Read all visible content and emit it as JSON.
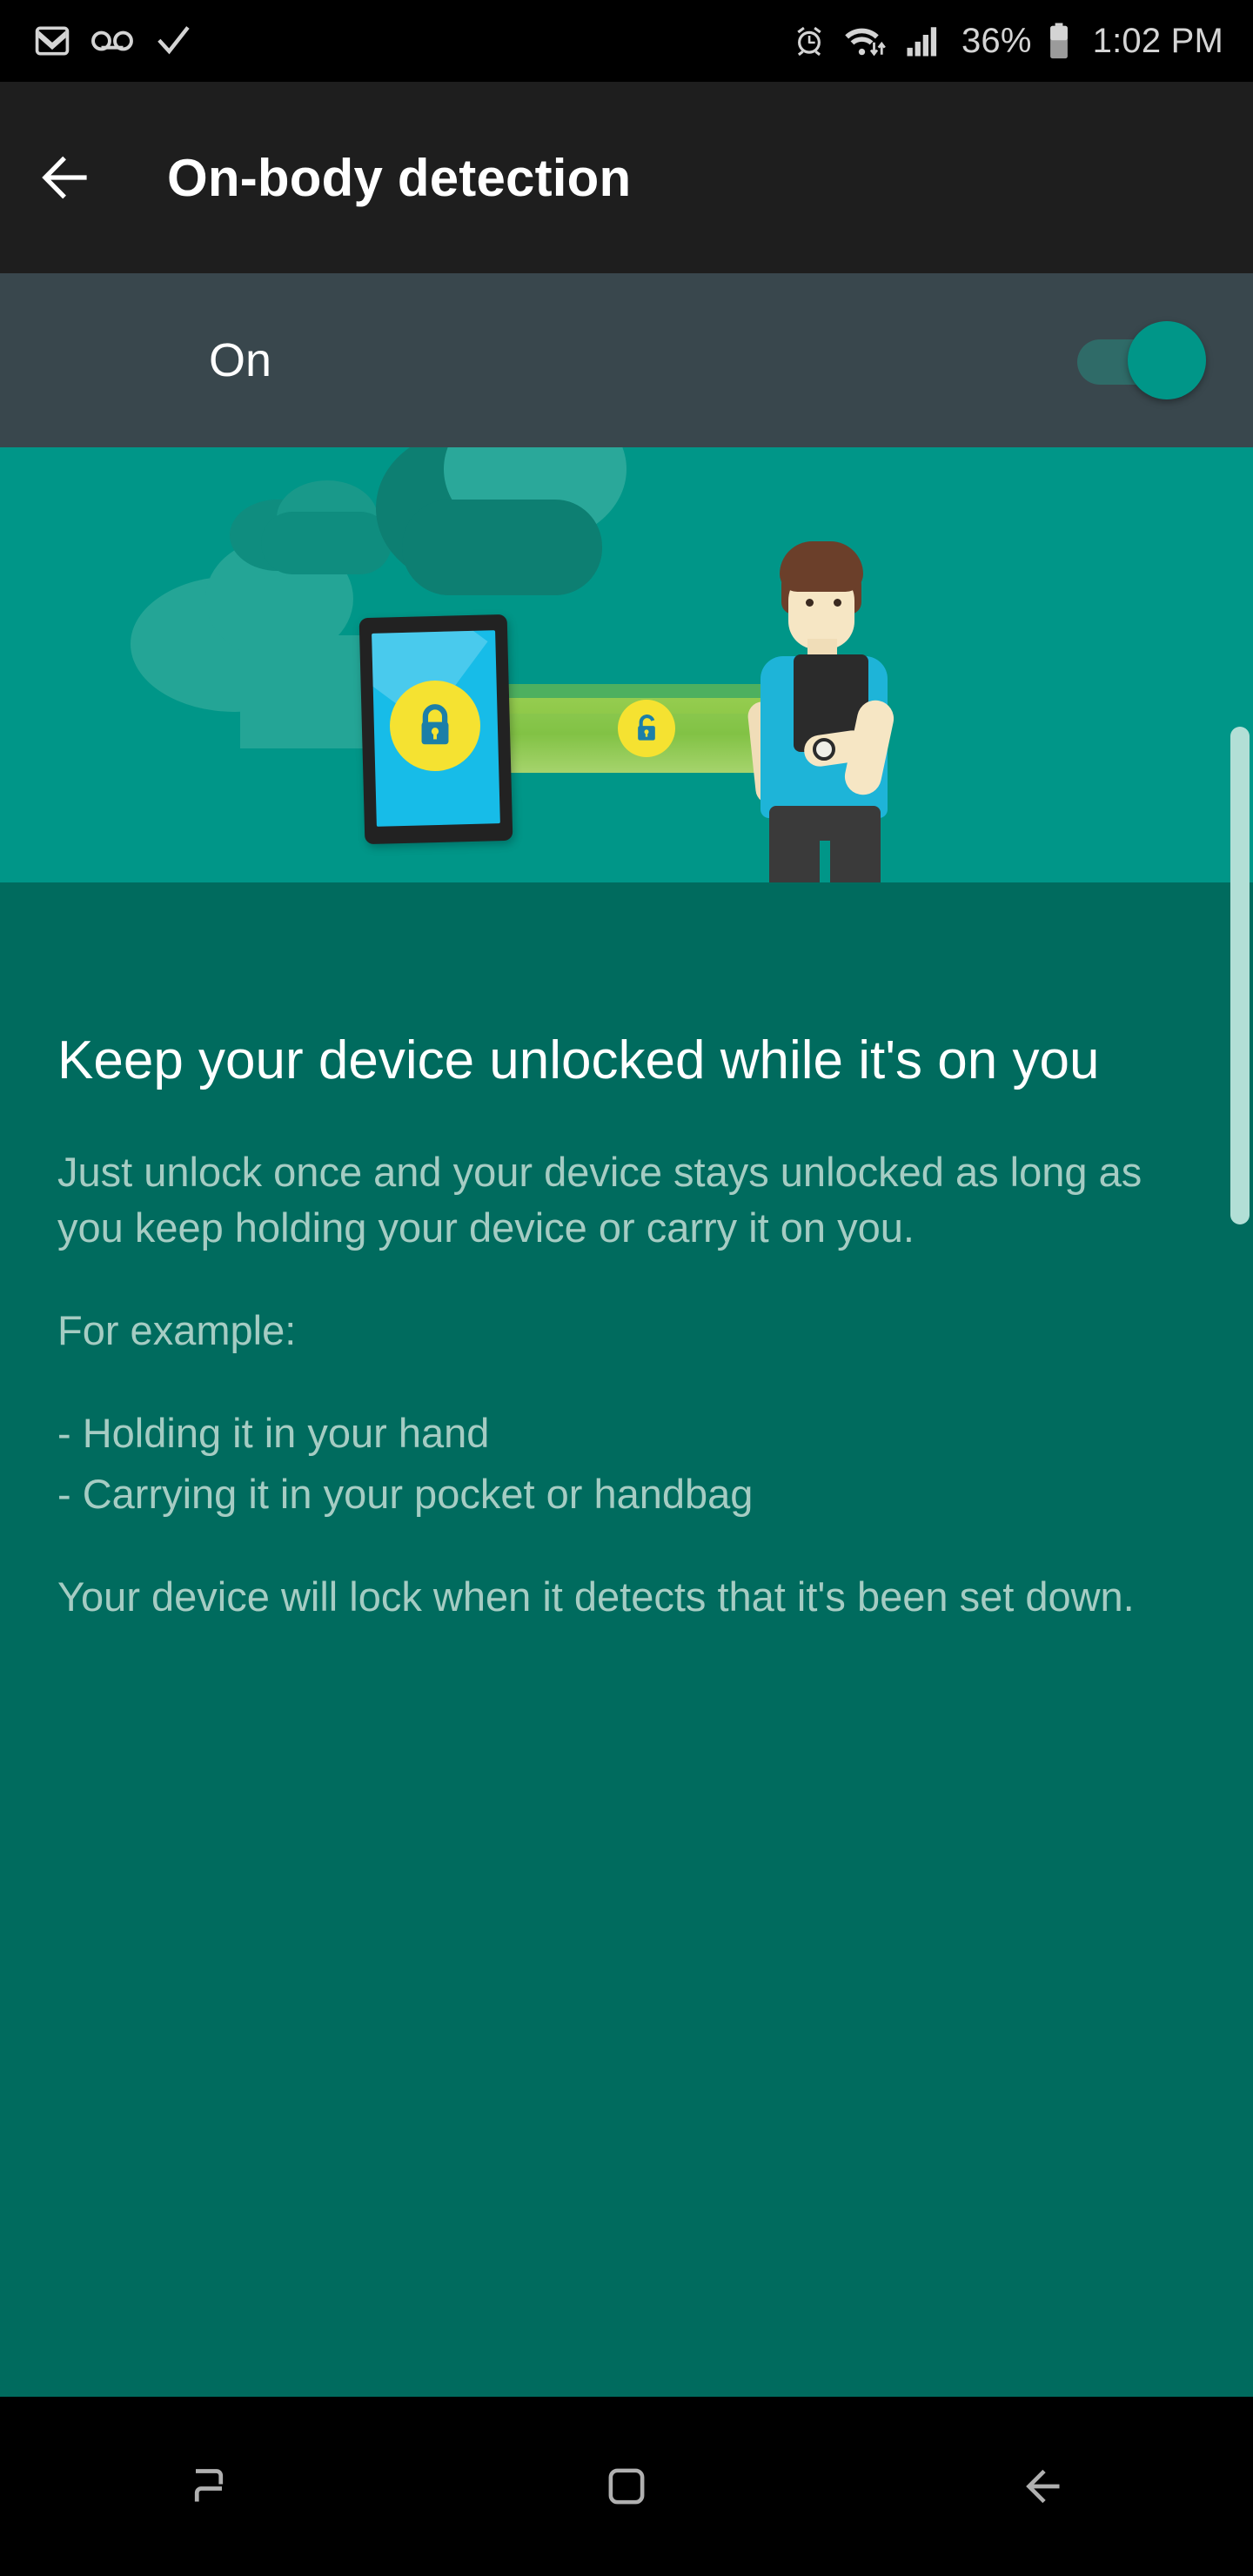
{
  "statusbar": {
    "left_icons": [
      "gmail-icon",
      "voicemail-icon",
      "check-icon"
    ],
    "right_icons": [
      "alarm-icon",
      "wifi-icon",
      "signal-icon",
      "battery-icon"
    ],
    "battery_percent": "36%",
    "time": "1:02 PM"
  },
  "appbar": {
    "back_icon": "back-arrow-icon",
    "title": "On-body detection"
  },
  "switch_row": {
    "label": "On",
    "state": "on",
    "track_color": "#2f6b68",
    "thumb_color": "#009688"
  },
  "hero": {
    "background_color": "#009688",
    "lower_background_color": "#006B5E",
    "elements": [
      "cloud-shape",
      "phone-with-locked-padlock",
      "green-signal-beam",
      "unlocked-padlock",
      "person-holding-device"
    ],
    "phone_screen_color": "#17bce8",
    "padlock_circle_color": "#f5e231",
    "beam_color": "#8dc63f",
    "shirt_color": "#1eb4d8",
    "hair_color": "#6b3f2a"
  },
  "scrollbar": {
    "name": "vertical-scrollbar",
    "color": "#b2dfd6"
  },
  "content": {
    "headline": "Keep your device unlocked while it's on you",
    "paragraph_1": "Just unlock once and your device stays unlocked as long as you keep holding your device or carry it on you.",
    "paragraph_2": "For example:",
    "bullets": [
      "- Holding it in your hand",
      "- Carrying it in your pocket or handbag"
    ],
    "paragraph_3": "Your device will lock when it detects that it's been set down.",
    "headline_color": "#ffffff",
    "body_color": "#a5ccc3"
  },
  "navbar": {
    "buttons": [
      {
        "name": "recents-button",
        "icon": "recents-icon"
      },
      {
        "name": "home-button",
        "icon": "home-square-icon"
      },
      {
        "name": "back-button",
        "icon": "back-arrow-icon"
      }
    ]
  }
}
